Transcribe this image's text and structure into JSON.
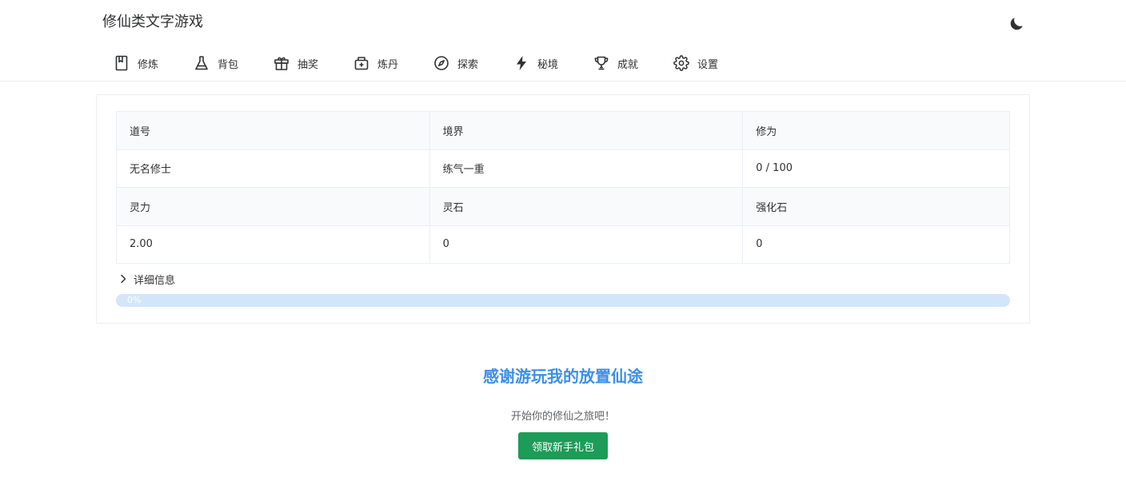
{
  "header": {
    "title": "修仙类文字游戏",
    "theme_icon": "moon-icon"
  },
  "nav": {
    "items": [
      {
        "label": "修炼",
        "icon": "book-icon"
      },
      {
        "label": "背包",
        "icon": "flask-icon"
      },
      {
        "label": "抽奖",
        "icon": "gift-icon"
      },
      {
        "label": "炼丹",
        "icon": "medkit-icon"
      },
      {
        "label": "探索",
        "icon": "compass-icon"
      },
      {
        "label": "秘境",
        "icon": "lightning-icon"
      },
      {
        "label": "成就",
        "icon": "trophy-icon"
      },
      {
        "label": "设置",
        "icon": "gear-icon"
      }
    ]
  },
  "stats": {
    "headers_row1": [
      "道号",
      "境界",
      "修为"
    ],
    "values_row1": [
      "无名修士",
      "练气一重",
      "0 / 100"
    ],
    "headers_row2": [
      "灵力",
      "灵石",
      "强化石"
    ],
    "values_row2": [
      "2.00",
      "0",
      "0"
    ]
  },
  "details": {
    "label": "详细信息"
  },
  "progress": {
    "value": 0,
    "text": "0%"
  },
  "welcome": {
    "title": "感谢游玩我的放置仙途",
    "subtitle": "开始你的修仙之旅吧！",
    "button_label": "领取新手礼包"
  },
  "colors": {
    "accent": "#3b8fe9",
    "progress_track": "#d3e6f9",
    "button_green": "#1c9c57"
  }
}
